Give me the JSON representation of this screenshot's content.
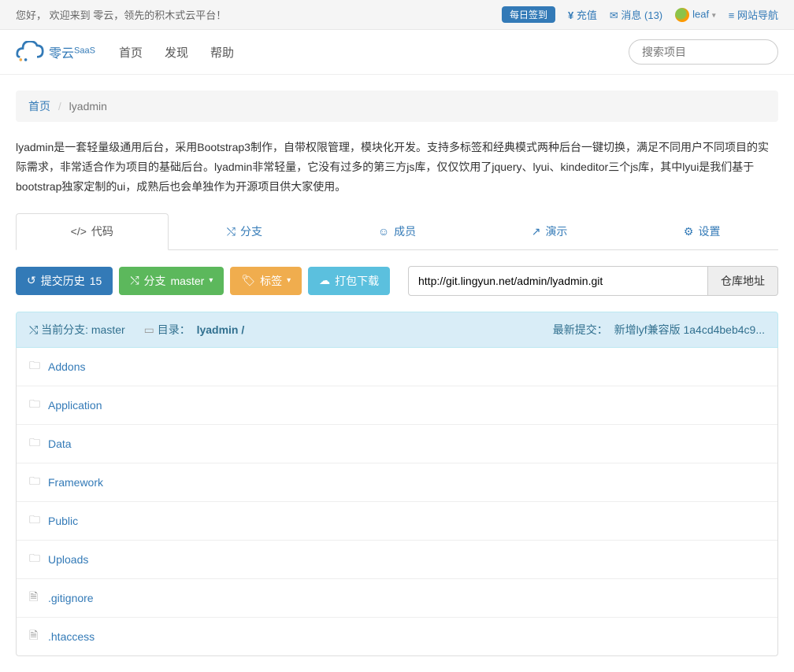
{
  "topbar": {
    "welcome": "您好， 欢迎来到 零云，领先的积木式云平台！",
    "checkin": "每日签到",
    "recharge": "充值",
    "messages_label": "消息",
    "messages_count": "(13)",
    "username": "leaf",
    "sitemap": "网站导航"
  },
  "navbar": {
    "brand": "零云",
    "brand_sub": "SaaS",
    "links": [
      "首页",
      "发现",
      "帮助"
    ],
    "search_placeholder": "搜索项目"
  },
  "breadcrumb": {
    "home": "首页",
    "sep": "/",
    "current": "lyadmin"
  },
  "description": "lyadmin是一套轻量级通用后台，采用Bootstrap3制作，自带权限管理，模块化开发。支持多标签和经典模式两种后台一键切换，满足不同用户不同项目的实际需求，非常适合作为项目的基础后台。lyadmin非常轻量，它没有过多的第三方js库，仅仅饮用了jquery、lyui、kindeditor三个js库，其中lyui是我们基于bootstrap独家定制的ui，成熟后也会单独作为开源项目供大家使用。",
  "tabs": [
    {
      "icon": "</>",
      "label": "代码",
      "active": true
    },
    {
      "icon": "⤭",
      "label": "分支",
      "active": false
    },
    {
      "icon": "☺",
      "label": "成员",
      "active": false
    },
    {
      "icon": "↗",
      "label": "演示",
      "active": false
    },
    {
      "icon": "⚙",
      "label": "设置",
      "active": false
    }
  ],
  "toolbar": {
    "history_label": "提交历史",
    "history_count": "15",
    "branch_label": "分支",
    "branch_value": "master",
    "tag_label": "标签",
    "download_label": "打包下载",
    "repo_url": "http://git.lingyun.net/admin/lyadmin.git",
    "repo_btn": "仓库地址"
  },
  "repo_header": {
    "branch_prefix": "当前分支:",
    "branch": "master",
    "dir_label": "目录：",
    "dir_path": "lyadmin /",
    "latest_label": "最新提交：",
    "commit_msg": "新增lyf兼容版",
    "commit_hash": "1a4cd4beb4c9..."
  },
  "files": [
    {
      "type": "folder",
      "name": "Addons"
    },
    {
      "type": "folder",
      "name": "Application"
    },
    {
      "type": "folder",
      "name": "Data"
    },
    {
      "type": "folder",
      "name": "Framework"
    },
    {
      "type": "folder",
      "name": "Public"
    },
    {
      "type": "folder",
      "name": "Uploads"
    },
    {
      "type": "file",
      "name": ".gitignore"
    },
    {
      "type": "file",
      "name": ".htaccess"
    }
  ]
}
